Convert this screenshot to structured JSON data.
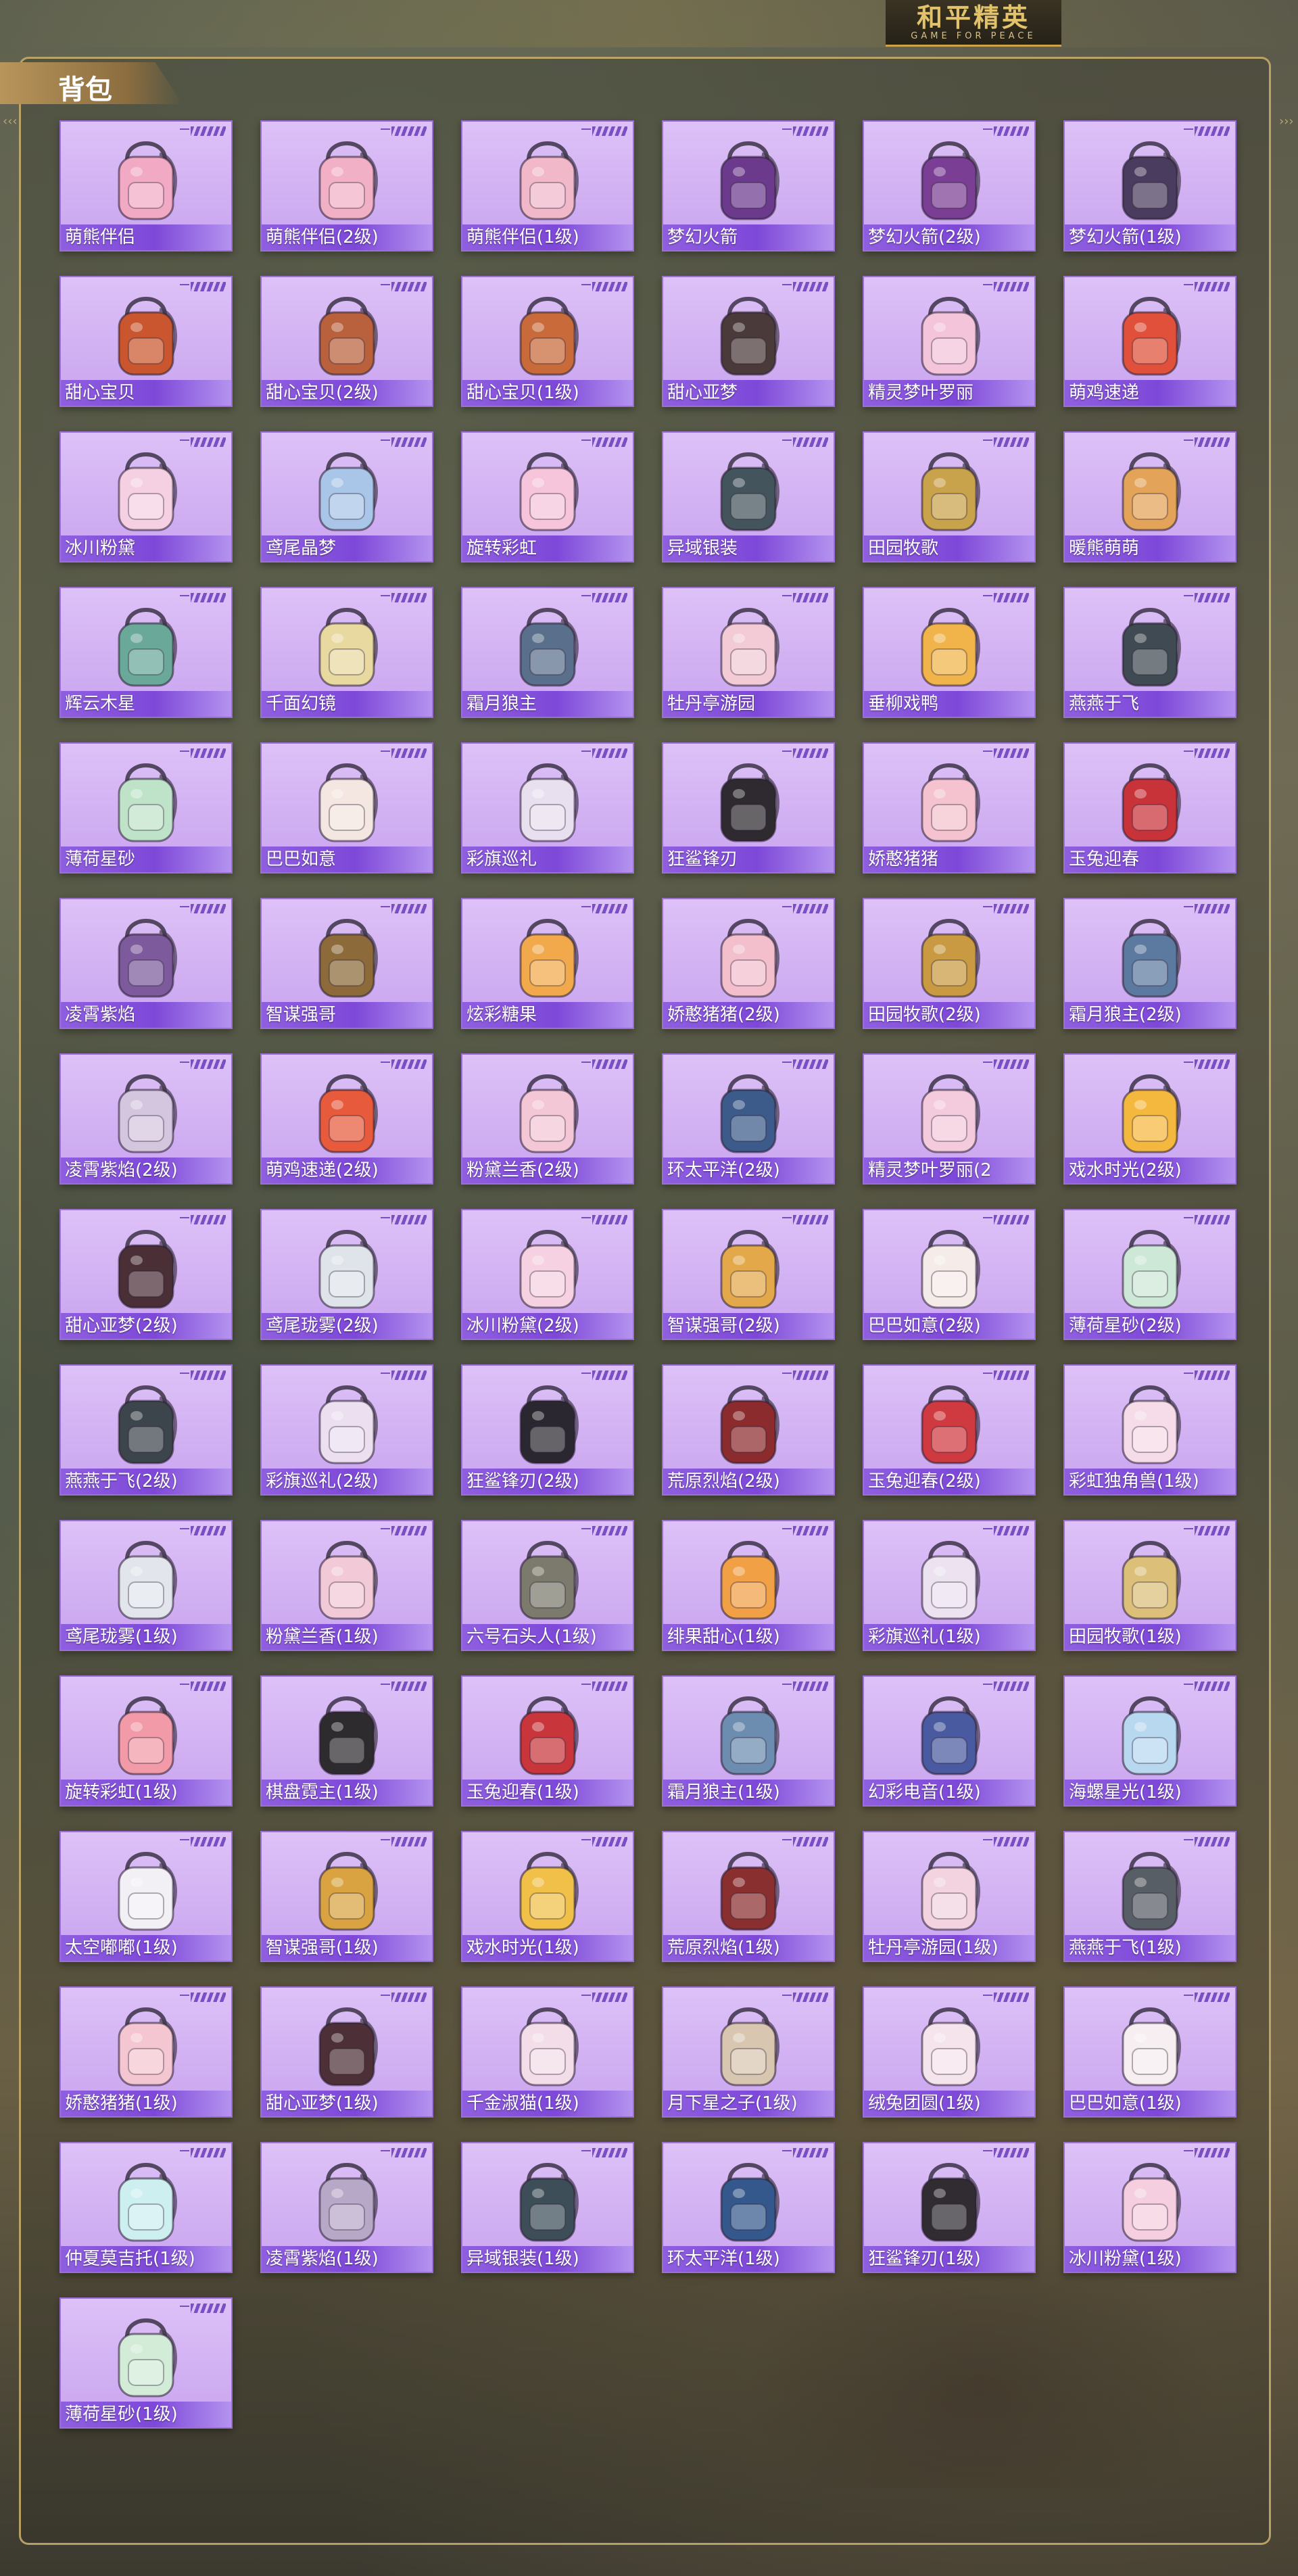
{
  "brand": {
    "title": "和平精英",
    "subtitle": "GAME FOR PEACE"
  },
  "panel": {
    "title": "背包"
  },
  "colors": {
    "card_bg": "#d8b8f5",
    "label_bar": "#7d48d8",
    "panel_border": "#cdb26e",
    "brand_gold": "#e2c26b"
  },
  "items": [
    {
      "name": "萌熊伴侣",
      "icon": "pink-bear-backpack-icon",
      "color": "#f2a9c4"
    },
    {
      "name": "萌熊伴侣(2级)",
      "icon": "pink-bear-backpack-icon",
      "color": "#f2b0c6"
    },
    {
      "name": "萌熊伴侣(1级)",
      "icon": "pink-bear-backpack-icon",
      "color": "#f0b8c9"
    },
    {
      "name": "梦幻火箭",
      "icon": "rocket-backpack-icon",
      "color": "#6b3a8c"
    },
    {
      "name": "梦幻火箭(2级)",
      "icon": "rocket-backpack-icon",
      "color": "#7a3f94"
    },
    {
      "name": "梦幻火箭(1级)",
      "icon": "rocket-backpack-icon",
      "color": "#4a3c5e"
    },
    {
      "name": "甜心宝贝",
      "icon": "dessert-backpack-icon",
      "color": "#c9562e"
    },
    {
      "name": "甜心宝贝(2级)",
      "icon": "dessert-backpack-icon",
      "color": "#b9613c"
    },
    {
      "name": "甜心宝贝(1级)",
      "icon": "dessert-backpack-icon",
      "color": "#c86a3a"
    },
    {
      "name": "甜心亚梦",
      "icon": "dark-backpack-icon",
      "color": "#4a3a3a"
    },
    {
      "name": "精灵梦叶罗丽",
      "icon": "heart-backpack-icon",
      "color": "#f3c4da"
    },
    {
      "name": "萌鸡速递",
      "icon": "chick-backpack-icon",
      "color": "#e0503a"
    },
    {
      "name": "冰川粉黛",
      "icon": "wing-backpack-icon",
      "color": "#f5d0e2"
    },
    {
      "name": "鸢尾晶梦",
      "icon": "crystal-backpack-icon",
      "color": "#a9c6e8"
    },
    {
      "name": "旋转彩虹",
      "icon": "dress-backpack-icon",
      "color": "#f6c5dc"
    },
    {
      "name": "异域银装",
      "icon": "metal-backpack-icon",
      "color": "#44545c"
    },
    {
      "name": "田园牧歌",
      "icon": "basket-backpack-icon",
      "color": "#c9a24c"
    },
    {
      "name": "暖熊萌萌",
      "icon": "bear-backpack-icon",
      "color": "#e3a358"
    },
    {
      "name": "辉云木星",
      "icon": "planet-backpack-icon",
      "color": "#6aa89a"
    },
    {
      "name": "千面幻镜",
      "icon": "mirror-backpack-icon",
      "color": "#e8d9a0"
    },
    {
      "name": "霜月狼主",
      "icon": "wolf-backpack-icon",
      "color": "#5a6f8c"
    },
    {
      "name": "牡丹亭游园",
      "icon": "peony-backpack-icon",
      "color": "#f2cbd6"
    },
    {
      "name": "垂柳戏鸭",
      "icon": "duck-backpack-icon",
      "color": "#f0b44a"
    },
    {
      "name": "燕燕于飞",
      "icon": "swallow-backpack-icon",
      "color": "#3f4a52"
    },
    {
      "name": "薄荷星砂",
      "icon": "mint-backpack-icon",
      "color": "#bfe3c9"
    },
    {
      "name": "巴巴如意",
      "icon": "rabbit-backpack-icon",
      "color": "#f4e6e0"
    },
    {
      "name": "彩旗巡礼",
      "icon": "flag-backpack-icon",
      "color": "#e9e0ef"
    },
    {
      "name": "狂鲨锋刃",
      "icon": "shark-backpack-icon",
      "color": "#2e2a30"
    },
    {
      "name": "娇憨猪猪",
      "icon": "pig-backpack-icon",
      "color": "#f4c3cf"
    },
    {
      "name": "玉兔迎春",
      "icon": "red-backpack-icon",
      "color": "#c8333a"
    },
    {
      "name": "凌霄紫焰",
      "icon": "purple-flame-backpack-icon",
      "color": "#7c5a9c"
    },
    {
      "name": "智谋强哥",
      "icon": "bear-backpack-icon",
      "color": "#8c6a3a"
    },
    {
      "name": "炫彩糖果",
      "icon": "candy-backpack-icon",
      "color": "#f1a94c"
    },
    {
      "name": "娇憨猪猪(2级)",
      "icon": "pig-backpack-icon",
      "color": "#f3bfcd"
    },
    {
      "name": "田园牧歌(2级)",
      "icon": "basket-backpack-icon",
      "color": "#c99a42"
    },
    {
      "name": "霜月狼主(2级)",
      "icon": "wolf-backpack-icon",
      "color": "#5c7aa0"
    },
    {
      "name": "凌霄紫焰(2级)",
      "icon": "purple-flame-backpack-icon",
      "color": "#d4c6df"
    },
    {
      "name": "萌鸡速递(2级)",
      "icon": "chick-backpack-icon",
      "color": "#e75a3c"
    },
    {
      "name": "粉黛兰香(2级)",
      "icon": "flower-backpack-icon",
      "color": "#f3c7d6"
    },
    {
      "name": "环太平洋(2级)",
      "icon": "mecha-backpack-icon",
      "color": "#3c5a8a"
    },
    {
      "name": "精灵梦叶罗丽(2",
      "icon": "heart-backpack-icon",
      "color": "#f4cbdd"
    },
    {
      "name": "戏水时光(2级)",
      "icon": "duck-backpack-icon",
      "color": "#f5b83f"
    },
    {
      "name": "甜心亚梦(2级)",
      "icon": "dark-backpack-icon",
      "color": "#4a2f36"
    },
    {
      "name": "鸢尾珑雾(2级)",
      "icon": "bag-backpack-icon",
      "color": "#dfe3ea"
    },
    {
      "name": "冰川粉黛(2级)",
      "icon": "wing-backpack-icon",
      "color": "#f6d1e1"
    },
    {
      "name": "智谋强哥(2级)",
      "icon": "bear-backpack-icon",
      "color": "#e3a84a"
    },
    {
      "name": "巴巴如意(2级)",
      "icon": "rabbit-backpack-icon",
      "color": "#f5ecea"
    },
    {
      "name": "薄荷星砂(2级)",
      "icon": "mint-backpack-icon",
      "color": "#cde8d6"
    },
    {
      "name": "燕燕于飞(2级)",
      "icon": "swallow-backpack-icon",
      "color": "#3c454c"
    },
    {
      "name": "彩旗巡礼(2级)",
      "icon": "flag-backpack-icon",
      "color": "#ebdff0"
    },
    {
      "name": "狂鲨锋刃(2级)",
      "icon": "shark-backpack-icon",
      "color": "#2b2730"
    },
    {
      "name": "荒原烈焰(2级)",
      "icon": "flame-backpack-icon",
      "color": "#8c2b2e"
    },
    {
      "name": "玉兔迎春(2级)",
      "icon": "red-backpack-icon",
      "color": "#cf3a40"
    },
    {
      "name": "彩虹独角兽(1级)",
      "icon": "unicorn-backpack-icon",
      "color": "#f6dbe8"
    },
    {
      "name": "鸢尾珑雾(1级)",
      "icon": "bag-backpack-icon",
      "color": "#e2e6ec"
    },
    {
      "name": "粉黛兰香(1级)",
      "icon": "flower-backpack-icon",
      "color": "#f2c9d6"
    },
    {
      "name": "六号石头人(1级)",
      "icon": "stone-backpack-icon",
      "color": "#7b7a6c"
    },
    {
      "name": "绯果甜心(1级)",
      "icon": "fruit-backpack-icon",
      "color": "#f2a046"
    },
    {
      "name": "彩旗巡礼(1级)",
      "icon": "flag-backpack-icon",
      "color": "#ece2f0"
    },
    {
      "name": "田园牧歌(1级)",
      "icon": "basket-backpack-icon",
      "color": "#dcc07a"
    },
    {
      "name": "旋转彩虹(1级)",
      "icon": "dress-backpack-icon",
      "color": "#f29aa8"
    },
    {
      "name": "棋盘霓主(1级)",
      "icon": "chess-backpack-icon",
      "color": "#2e2b2e"
    },
    {
      "name": "玉兔迎春(1级)",
      "icon": "red-backpack-icon",
      "color": "#c8363c"
    },
    {
      "name": "霜月狼主(1级)",
      "icon": "wolf-backpack-icon",
      "color": "#6c8cb0"
    },
    {
      "name": "幻彩电音(1级)",
      "icon": "speaker-backpack-icon",
      "color": "#4a5aa0"
    },
    {
      "name": "海螺星光(1级)",
      "icon": "shell-backpack-icon",
      "color": "#b8d8f0"
    },
    {
      "name": "太空嘟嘟(1级)",
      "icon": "space-backpack-icon",
      "color": "#f3f0f5"
    },
    {
      "name": "智谋强哥(1级)",
      "icon": "bear-backpack-icon",
      "color": "#d8a340"
    },
    {
      "name": "戏水时光(1级)",
      "icon": "duck-backpack-icon",
      "color": "#f0c048"
    },
    {
      "name": "荒原烈焰(1级)",
      "icon": "flame-backpack-icon",
      "color": "#8a2f30"
    },
    {
      "name": "牡丹亭游园(1级)",
      "icon": "peony-backpack-icon",
      "color": "#f2d3df"
    },
    {
      "name": "燕燕于飞(1级)",
      "icon": "swallow-backpack-icon",
      "color": "#585e66"
    },
    {
      "name": "娇憨猪猪(1级)",
      "icon": "pig-backpack-icon",
      "color": "#f4c6d2"
    },
    {
      "name": "甜心亚梦(1级)",
      "icon": "dark-backpack-icon",
      "color": "#4d3037"
    },
    {
      "name": "千金淑猫(1级)",
      "icon": "cat-backpack-icon",
      "color": "#f3dde8"
    },
    {
      "name": "月下星之子(1级)",
      "icon": "star-backpack-icon",
      "color": "#d8c6b0"
    },
    {
      "name": "绒兔团圆(1级)",
      "icon": "rabbit-backpack-icon",
      "color": "#f6e4ec"
    },
    {
      "name": "巴巴如意(1级)",
      "icon": "rabbit-backpack-icon",
      "color": "#f6eef0"
    },
    {
      "name": "仲夏莫吉托(1级)",
      "icon": "drink-backpack-icon",
      "color": "#cdeff0"
    },
    {
      "name": "凌霄紫焰(1级)",
      "icon": "purple-flame-backpack-icon",
      "color": "#b8a8c8"
    },
    {
      "name": "异域银装(1级)",
      "icon": "metal-backpack-icon",
      "color": "#3e4e58"
    },
    {
      "name": "环太平洋(1级)",
      "icon": "mecha-backpack-icon",
      "color": "#34588c"
    },
    {
      "name": "狂鲨锋刃(1级)",
      "icon": "shark-backpack-icon",
      "color": "#302c32"
    },
    {
      "name": "冰川粉黛(1级)",
      "icon": "wing-backpack-icon",
      "color": "#f5cfe0"
    },
    {
      "name": "薄荷星砂(1级)",
      "icon": "mint-backpack-icon",
      "color": "#d2ecd8"
    }
  ]
}
